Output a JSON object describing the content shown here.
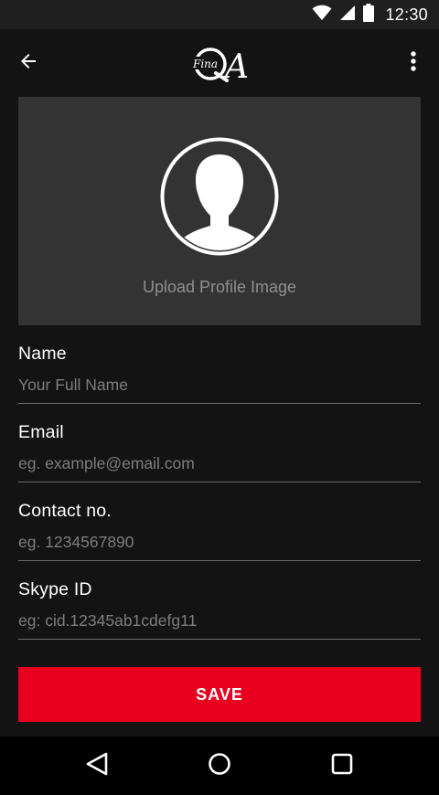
{
  "status_bar": {
    "time": "12:30",
    "icons": [
      "wifi-icon",
      "signal-icon",
      "battery-icon"
    ]
  },
  "app_bar": {
    "logo": {
      "script_text": "Fina",
      "letters": "QA"
    },
    "back_icon": "arrow-left-icon",
    "menu_icon": "more-vert-icon"
  },
  "profile": {
    "upload_label": "Upload Profile Image",
    "avatar_icon": "person-silhouette-icon"
  },
  "form": {
    "fields": [
      {
        "label": "Name",
        "placeholder": "Your Full Name",
        "value": ""
      },
      {
        "label": "Email",
        "placeholder": "eg. example@email.com",
        "value": ""
      },
      {
        "label": "Contact no.",
        "placeholder": "eg. 1234567890",
        "value": ""
      },
      {
        "label": "Skype ID",
        "placeholder": "eg: cid.12345ab1cdefg11",
        "value": ""
      }
    ],
    "save_label": "SAVE"
  },
  "colors": {
    "background": "#131313",
    "panel": "#333333",
    "accent": "#e8001e",
    "placeholder": "#7d7d7d"
  },
  "nav_bar": {
    "icons": [
      "back-triangle-icon",
      "home-circle-icon",
      "recents-square-icon"
    ]
  }
}
